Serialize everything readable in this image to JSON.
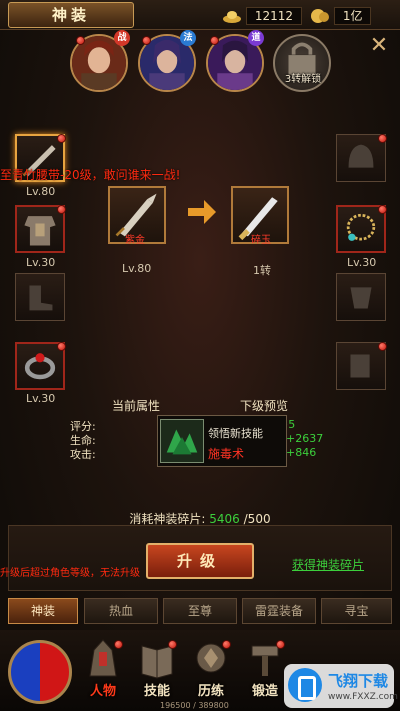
{
  "header": {
    "title": "神装",
    "gold": "12112",
    "coin": "1亿"
  },
  "heroes": [
    {
      "role": "战",
      "role_color": "#d3382a"
    },
    {
      "role": "法",
      "role_color": "#2a7bd3"
    },
    {
      "role": "道",
      "role_color": "#7a3ad3"
    }
  ],
  "locked_hero_label": "3转解锁",
  "marquee": "至青竹腰带-20级，敢问谁来一战!",
  "left_slots": [
    {
      "level": "Lv.80"
    },
    {
      "level": "Lv.30"
    },
    {
      "level": ""
    },
    {
      "level": "Lv.30"
    }
  ],
  "right_slots": [
    {
      "level": ""
    },
    {
      "level": "Lv.30"
    },
    {
      "level": ""
    },
    {
      "level": ""
    }
  ],
  "current_item": {
    "tag": "紫金",
    "level": "Lv.80"
  },
  "next_item": {
    "tag": "碎玉",
    "level": "1转"
  },
  "attributes": {
    "current_header": "当前属性",
    "next_header": "下级预览",
    "rows": [
      {
        "label": "评分:",
        "next": "277+5"
      },
      {
        "label": "生命:",
        "next": "5051+2637"
      },
      {
        "label": "攻击:",
        "next": "5644+846"
      }
    ]
  },
  "skill_tooltip": {
    "line1": "领悟新技能",
    "line2": "施毒术"
  },
  "cost": {
    "label": "消耗神装碎片:",
    "have": "5406",
    "need": "/500"
  },
  "upgrade_button": "升级",
  "get_shards_link": "获得神装碎片",
  "warning": "升级后超过角色等级，无法升级",
  "tabs": [
    "神装",
    "热血",
    "至尊",
    "雷霆装备",
    "寻宝"
  ],
  "nav": [
    "人物",
    "技能",
    "历练",
    "锻造"
  ],
  "xp_text": "196500 / 389800",
  "watermark": {
    "name": "飞翔下载",
    "url": "www.FXXZ.com"
  },
  "colors": {
    "accent_gold": "#c79a55",
    "alert_red": "#ff2a10",
    "link_green": "#3ccf3c"
  }
}
